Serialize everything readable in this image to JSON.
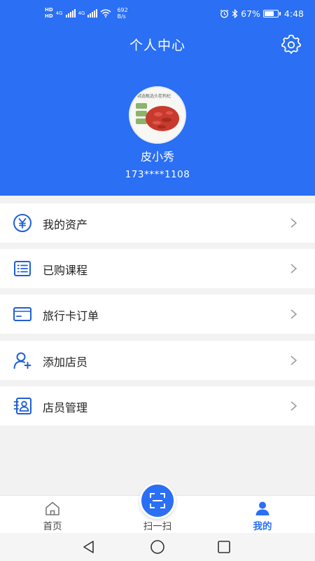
{
  "status_bar": {
    "hd_top": "HD",
    "hd_bottom": "HD",
    "network_1": "4G",
    "network_2": "4G",
    "speed_value": "692",
    "speed_unit": "B/s",
    "battery": "67%",
    "battery_level": 0.67,
    "time": "4:48"
  },
  "header": {
    "title": "个人中心",
    "avatar_caption": "精选甄选头茬枸杞",
    "username": "皮小秀",
    "phone": "173****1108",
    "accent_color": "#2a6ff4"
  },
  "menu": {
    "items": [
      {
        "label": "我的资产",
        "icon": "yuan-icon"
      },
      {
        "label": "已购课程",
        "icon": "list-icon"
      },
      {
        "label": "旅行卡订单",
        "icon": "card-icon"
      },
      {
        "label": "添加店员",
        "icon": "add-user-icon"
      },
      {
        "label": "店员管理",
        "icon": "staff-card-icon"
      }
    ]
  },
  "tabbar": {
    "home": "首页",
    "scan": "扫一扫",
    "mine": "我的",
    "active": "mine",
    "active_color": "#2a6ff4"
  },
  "system_nav": {
    "back": "back-icon",
    "home": "home-circle-icon",
    "recents": "recents-icon"
  }
}
